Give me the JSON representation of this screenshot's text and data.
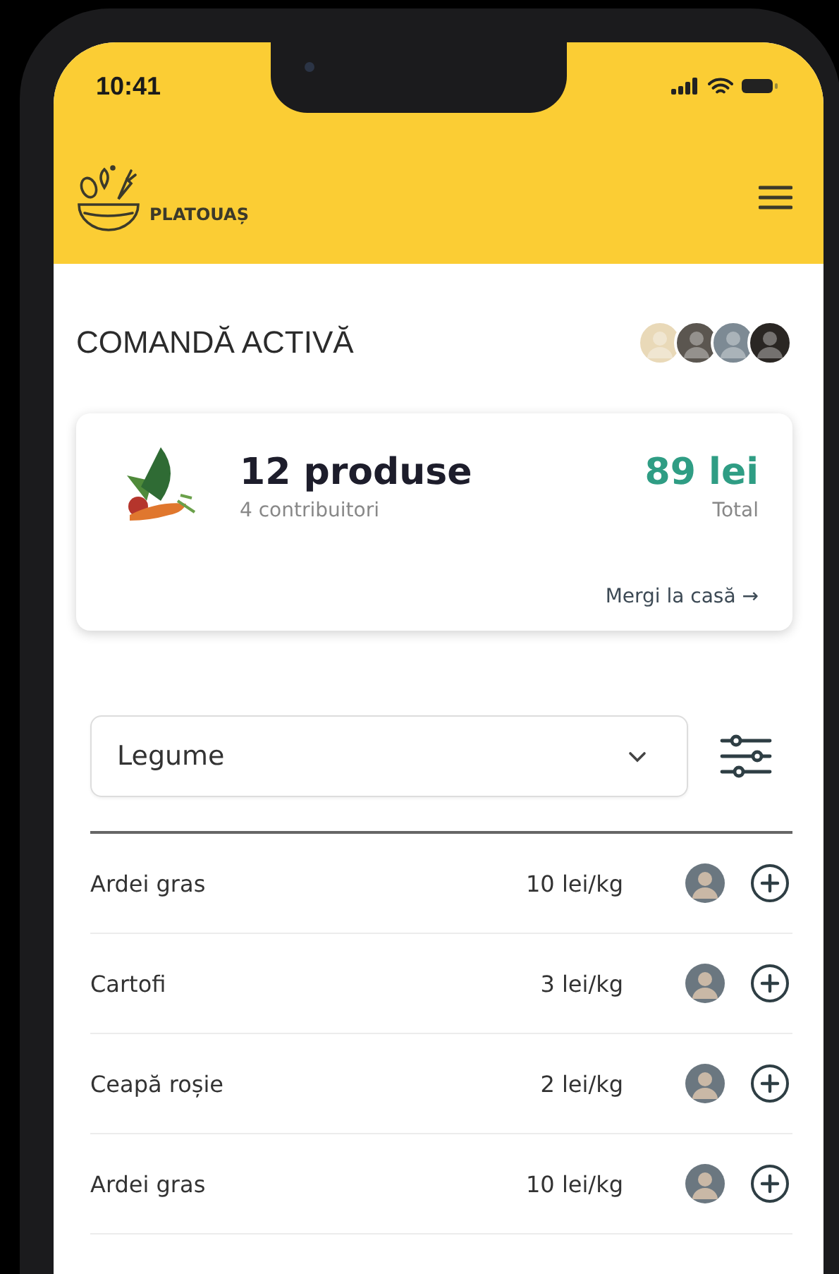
{
  "status_bar": {
    "time": "10:41"
  },
  "header": {
    "brand": "PLATOUAȘ"
  },
  "order": {
    "title": "COMANDĂ ACTIVĂ",
    "products": "12 produse",
    "contributors": "4 contribuitori",
    "total": "89 lei",
    "total_label": "Total",
    "checkout_link": "Mergi la casă →"
  },
  "filter": {
    "category": "Legume"
  },
  "products": [
    {
      "name": "Ardei gras",
      "price": "10 lei/kg"
    },
    {
      "name": "Cartofi",
      "price": "3 lei/kg"
    },
    {
      "name": "Ceapă roșie",
      "price": "2 lei/kg"
    },
    {
      "name": "Ardei gras",
      "price": "10 lei/kg"
    }
  ]
}
